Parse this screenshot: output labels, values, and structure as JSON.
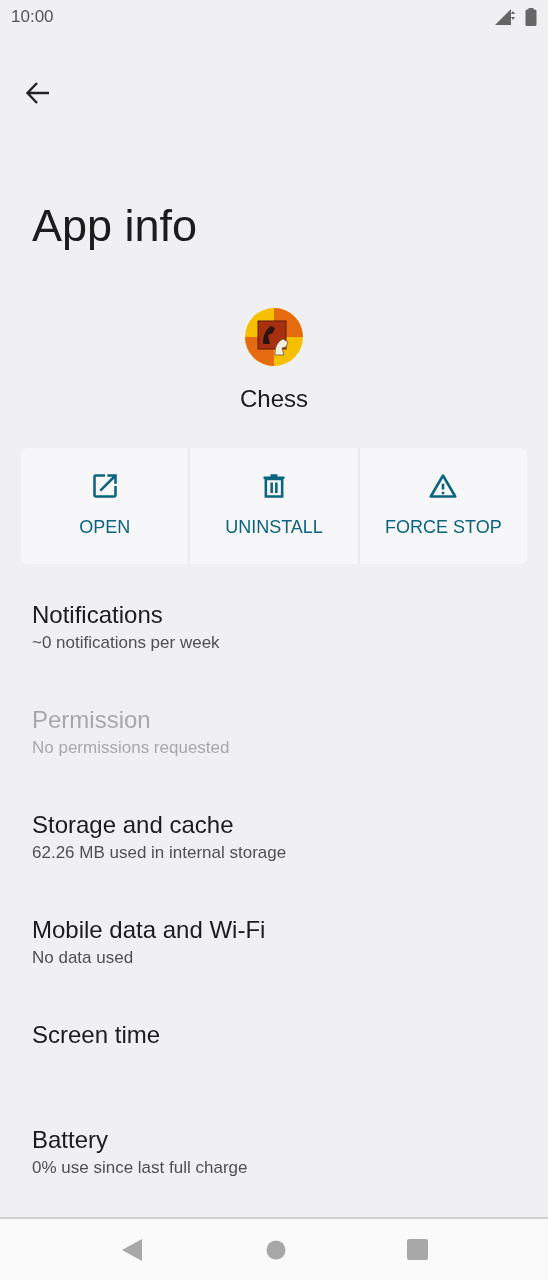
{
  "status_bar": {
    "time": "10:00"
  },
  "title": "App info",
  "app": {
    "name": "Chess"
  },
  "actions": [
    {
      "kind": "open",
      "label": "OPEN"
    },
    {
      "kind": "uninstall",
      "label": "UNINSTALL"
    },
    {
      "kind": "stop",
      "label": "FORCE STOP"
    }
  ],
  "settings": [
    {
      "title": "Notifications",
      "summary": "~0 notifications per week",
      "disabled": false
    },
    {
      "title": "Permission",
      "summary": "No permissions requested",
      "disabled": true
    },
    {
      "title": "Storage and cache",
      "summary": "62.26 MB used in internal storage",
      "disabled": false
    },
    {
      "title": "Mobile data and Wi-Fi",
      "summary": "No data used",
      "disabled": false
    },
    {
      "title": "Screen time",
      "disabled": false
    },
    {
      "title": "Battery",
      "summary": "0% use since last full charge",
      "disabled": false
    }
  ]
}
